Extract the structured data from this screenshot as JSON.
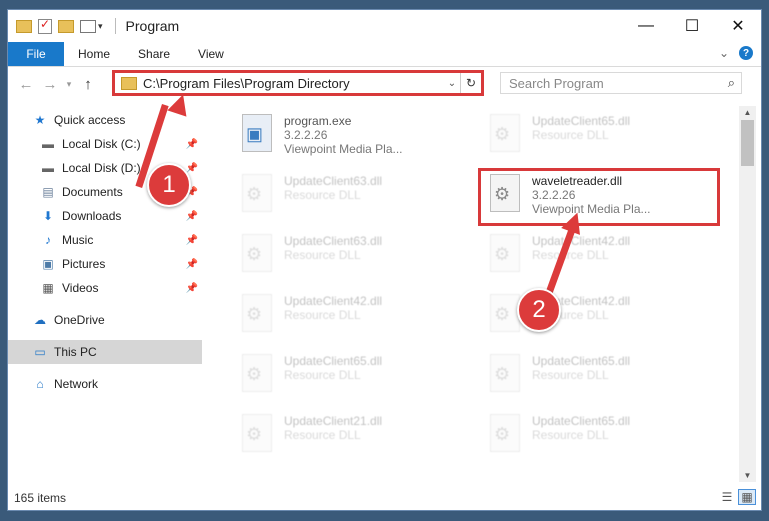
{
  "window": {
    "title": "Program",
    "controls": {
      "minimize": "—",
      "maximize": "☐",
      "close": "✕"
    }
  },
  "ribbon": {
    "tabs": [
      "File",
      "Home",
      "Share",
      "View"
    ],
    "help": "?"
  },
  "nav": {
    "back": "←",
    "forward": "→",
    "up": "↑",
    "address": "C:\\Program Files\\Program Directory",
    "refresh": "↻",
    "search_placeholder": "Search Program"
  },
  "sidebar": {
    "items": [
      {
        "label": "Quick access",
        "icon": "star-icon",
        "glyph": "★"
      },
      {
        "label": "Local Disk (C:)",
        "icon": "drive-icon",
        "glyph": "▬",
        "pinned": true
      },
      {
        "label": "Local Disk (D:)",
        "icon": "drive-icon",
        "glyph": "▬",
        "pinned": true
      },
      {
        "label": "Documents",
        "icon": "documents-icon",
        "glyph": "▤",
        "pinned": true
      },
      {
        "label": "Downloads",
        "icon": "downloads-icon",
        "glyph": "⬇",
        "pinned": true
      },
      {
        "label": "Music",
        "icon": "music-icon",
        "glyph": "♪",
        "pinned": true
      },
      {
        "label": "Pictures",
        "icon": "pictures-icon",
        "glyph": "▣",
        "pinned": true
      },
      {
        "label": "Videos",
        "icon": "videos-icon",
        "glyph": "▦",
        "pinned": true
      },
      {
        "label": "OneDrive",
        "icon": "cloud-icon",
        "glyph": "☁"
      },
      {
        "label": "This PC",
        "icon": "computer-icon",
        "glyph": "▭",
        "selected": true
      },
      {
        "label": "Network",
        "icon": "network-icon",
        "glyph": "⌂"
      }
    ]
  },
  "files": {
    "left": [
      {
        "name": "program.exe",
        "version": "3.2.2.26",
        "desc": "Viewpoint Media Pla..."
      },
      {
        "name": "UpdateClient63.dll",
        "desc": "Resource DLL"
      },
      {
        "name": "UpdateClient63.dll",
        "desc": "Resource DLL"
      },
      {
        "name": "UpdateClient42.dll",
        "desc": "Resource DLL"
      },
      {
        "name": "UpdateClient65.dll",
        "desc": "Resource DLL"
      },
      {
        "name": "UpdateClient21.dll",
        "desc": "Resource DLL"
      }
    ],
    "right": [
      {
        "name": "UpdateClient65.dll",
        "desc": "Resource DLL"
      },
      {
        "name": "waveletreader.dll",
        "version": "3.2.2.26",
        "desc": "Viewpoint Media Pla...",
        "highlight": true
      },
      {
        "name": "UpdateClient42.dll",
        "desc": "Resource DLL"
      },
      {
        "name": "UpdateClient42.dll",
        "desc": "Resource DLL"
      },
      {
        "name": "UpdateClient65.dll",
        "desc": "Resource DLL"
      },
      {
        "name": "UpdateClient65.dll",
        "desc": "Resource DLL"
      }
    ]
  },
  "status": {
    "count": "165 items"
  },
  "annotations": {
    "step1": "1",
    "step2": "2",
    "color": "#dc3b3b"
  }
}
